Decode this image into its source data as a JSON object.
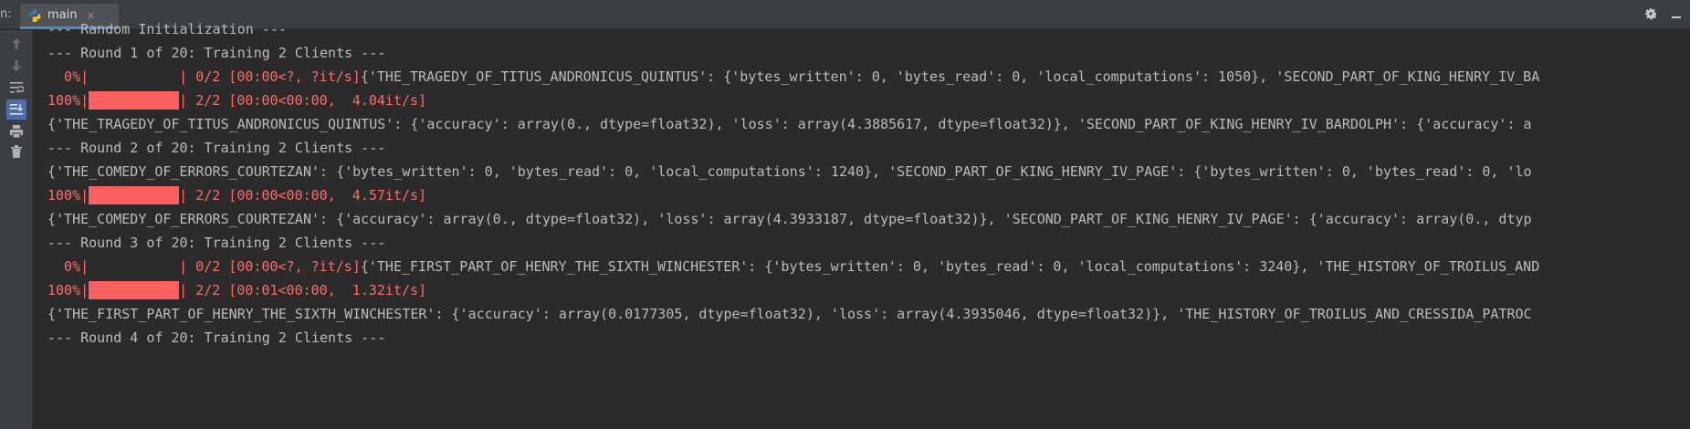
{
  "topbar": {
    "run_label": "n:",
    "tab_label": "main",
    "tab_close": "×",
    "settings_icon": "gear-icon",
    "minimize_icon": "minimize-icon"
  },
  "left_toolbar": {
    "icons": [
      "arrow-up-icon",
      "arrow-down-icon",
      "soft-wrap-icon",
      "scroll-to-end-icon",
      "print-icon",
      "trash-icon"
    ]
  },
  "colors": {
    "background": "#2b2b2b",
    "toolbar": "#3c3f41",
    "text": "#bbbbbb",
    "stderr_red": "#ff6b68",
    "progress_fill": "#ff5f5f",
    "tab_underline": "#4a88c7"
  },
  "console": {
    "line_0": "--- Random Initialization ---",
    "line_1": "--- Round 1 of 20: Training 2 Clients ---",
    "line_2": {
      "pct": "  0%|",
      "rest": "| 0/2 [00:00<?, ?it/s]",
      "tail": "{'THE_TRAGEDY_OF_TITUS_ANDRONICUS_QUINTUS': {'bytes_written': 0, 'bytes_read': 0, 'local_computations': 1050}, 'SECOND_PART_OF_KING_HENRY_IV_BA"
    },
    "line_3": {
      "pct": "100%|",
      "rest": "| 2/2 [00:00<00:00,  4.04it/s]"
    },
    "line_4": "{'THE_TRAGEDY_OF_TITUS_ANDRONICUS_QUINTUS': {'accuracy': array(0., dtype=float32), 'loss': array(4.3885617, dtype=float32)}, 'SECOND_PART_OF_KING_HENRY_IV_BARDOLPH': {'accuracy': a",
    "line_5": "--- Round 2 of 20: Training 2 Clients ---",
    "line_6": "{'THE_COMEDY_OF_ERRORS_COURTEZAN': {'bytes_written': 0, 'bytes_read': 0, 'local_computations': 1240}, 'SECOND_PART_OF_KING_HENRY_IV_PAGE': {'bytes_written': 0, 'bytes_read': 0, 'lo",
    "line_7": {
      "pct": "100%|",
      "rest": "| 2/2 [00:00<00:00,  4.57it/s]"
    },
    "line_8": "{'THE_COMEDY_OF_ERRORS_COURTEZAN': {'accuracy': array(0., dtype=float32), 'loss': array(4.3933187, dtype=float32)}, 'SECOND_PART_OF_KING_HENRY_IV_PAGE': {'accuracy': array(0., dtyp",
    "line_9": "--- Round 3 of 20: Training 2 Clients ---",
    "line_10": {
      "pct": "  0%|",
      "rest": "| 0/2 [00:00<?, ?it/s]",
      "tail": "{'THE_FIRST_PART_OF_HENRY_THE_SIXTH_WINCHESTER': {'bytes_written': 0, 'bytes_read': 0, 'local_computations': 3240}, 'THE_HISTORY_OF_TROILUS_AND"
    },
    "line_11": {
      "pct": "100%|",
      "rest": "| 2/2 [00:01<00:00,  1.32it/s]"
    },
    "line_12": "{'THE_FIRST_PART_OF_HENRY_THE_SIXTH_WINCHESTER': {'accuracy': array(0.0177305, dtype=float32), 'loss': array(4.3935046, dtype=float32)}, 'THE_HISTORY_OF_TROILUS_AND_CRESSIDA_PATROC",
    "line_13": "--- Round 4 of 20: Training 2 Clients ---"
  },
  "progress": {
    "round1_start": 0.0,
    "round1_end": 1.0,
    "round2_end": 1.0,
    "round3_start": 0.0,
    "round3_end": 1.0
  }
}
